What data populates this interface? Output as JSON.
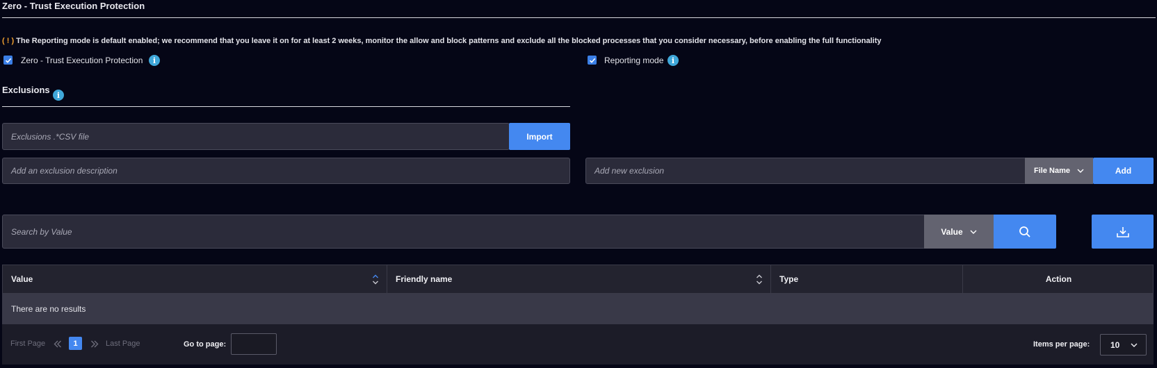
{
  "page": {
    "title": "Zero - Trust Execution Protection",
    "notice_prefix": "( ! )",
    "notice_text": "The Reporting mode is default enabled; we recommend that you leave it on for at least 2 weeks, monitor the allow and block patterns and exclude all the blocked processes that you consider necessary, before enabling the full functionality"
  },
  "toggles": {
    "ztep_label": "Zero - Trust Execution Protection",
    "ztep_checked": true,
    "reporting_label": "Reporting mode",
    "reporting_checked": true
  },
  "exclusions": {
    "title": "Exclusions",
    "csv_placeholder": "Exclusions .*CSV file",
    "import_label": "Import",
    "description_placeholder": "Add an exclusion description",
    "new_exclusion_placeholder": "Add new exclusion",
    "type_selected": "File Name",
    "add_label": "Add"
  },
  "search": {
    "placeholder": "Search by Value",
    "field_selected": "Value"
  },
  "table": {
    "columns": [
      "Value",
      "Friendly name",
      "Type",
      "Action"
    ],
    "empty_message": "There are no results"
  },
  "pagination": {
    "first_label": "First Page",
    "last_label": "Last Page",
    "current_page": "1",
    "goto_label": "Go to page:",
    "items_per_page_label": "Items per page:",
    "items_per_page_value": "10"
  },
  "colors": {
    "background": "#050616",
    "accent": "#4488f0",
    "info": "#3fa7d9",
    "warning": "#f0a030"
  }
}
